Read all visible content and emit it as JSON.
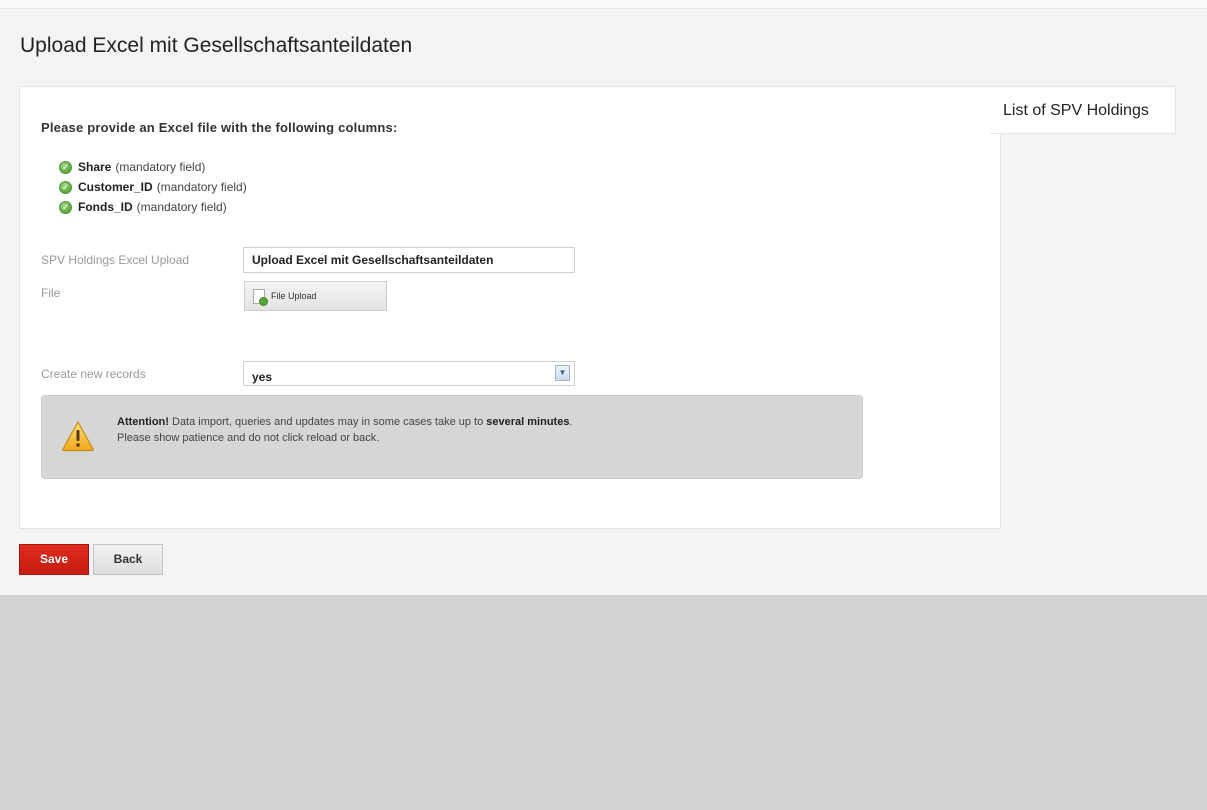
{
  "page": {
    "title": "Upload Excel mit Gesellschaftsanteildaten"
  },
  "side_tab": {
    "label": "List of SPV Holdings"
  },
  "intro": "Please provide an Excel file with the following columns:",
  "required_columns": [
    {
      "name": "Share",
      "note": "(mandatory field)"
    },
    {
      "name": "Customer_ID",
      "note": "(mandatory field)"
    },
    {
      "name": "Fonds_ID",
      "note": "(mandatory field)"
    }
  ],
  "form": {
    "upload_label": "SPV Holdings Excel Upload",
    "upload_value": "Upload Excel mit Gesellschaftsanteildaten",
    "file_label": "File",
    "file_button": "File Upload",
    "create_label": "Create new records",
    "create_value": "yes"
  },
  "warning": {
    "strong": "Attention!",
    "text1": "Data import, queries and updates may in some cases take up to",
    "emphasis": "several minutes",
    "text1_end": ".",
    "text2": "Please show patience and do not click reload or back."
  },
  "actions": {
    "save_label": "Save",
    "back_label": "Back"
  },
  "colors": {
    "save_button": "#d42418",
    "warning_box": "#d6d6d6",
    "check_icon": "#5aa73a",
    "page_background": "#f4f4f4",
    "lower_background": "#d3d3d3"
  },
  "icons": {
    "check": "check-circle-icon",
    "file": "file-add-icon",
    "warning": "warning-triangle-icon",
    "dropdown": "chevron-down-icon"
  }
}
